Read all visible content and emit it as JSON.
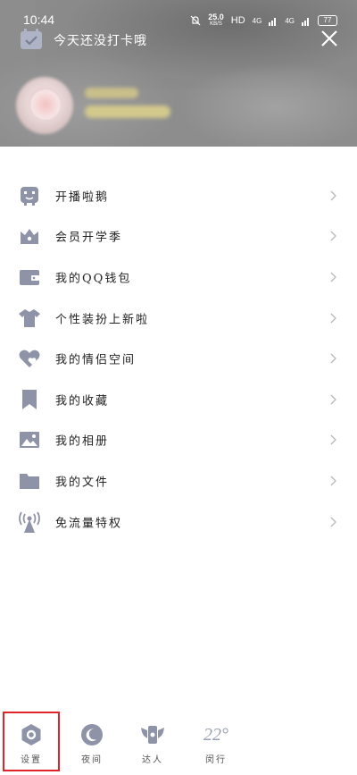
{
  "status_bar": {
    "time": "10:44",
    "net_speed": "25.0",
    "net_unit": "KB/S",
    "hd": "HD",
    "signal_1": "4G",
    "signal_2": "4G",
    "battery": "77"
  },
  "header": {
    "checkin_text": "今天还没打卡哦"
  },
  "menu": {
    "items": [
      {
        "label": "开播啦鹅",
        "icon": "tv-robot-icon"
      },
      {
        "label": "会员开学季",
        "icon": "crown-icon"
      },
      {
        "label": "我的QQ钱包",
        "icon": "wallet-icon"
      },
      {
        "label": "个性装扮上新啦",
        "icon": "shirt-icon"
      },
      {
        "label": "我的情侣空间",
        "icon": "heart-icon"
      },
      {
        "label": "我的收藏",
        "icon": "bookmark-icon"
      },
      {
        "label": "我的相册",
        "icon": "photo-icon"
      },
      {
        "label": "我的文件",
        "icon": "folder-icon"
      },
      {
        "label": "免流量特权",
        "icon": "antenna-icon"
      }
    ]
  },
  "bottom_bar": {
    "settings": "设置",
    "night": "夜间",
    "recommend": "达人",
    "weather_temp": "22°",
    "weather_city": "闵行"
  },
  "colors": {
    "icon": "#8e93a8",
    "highlight": "#e0242a"
  }
}
